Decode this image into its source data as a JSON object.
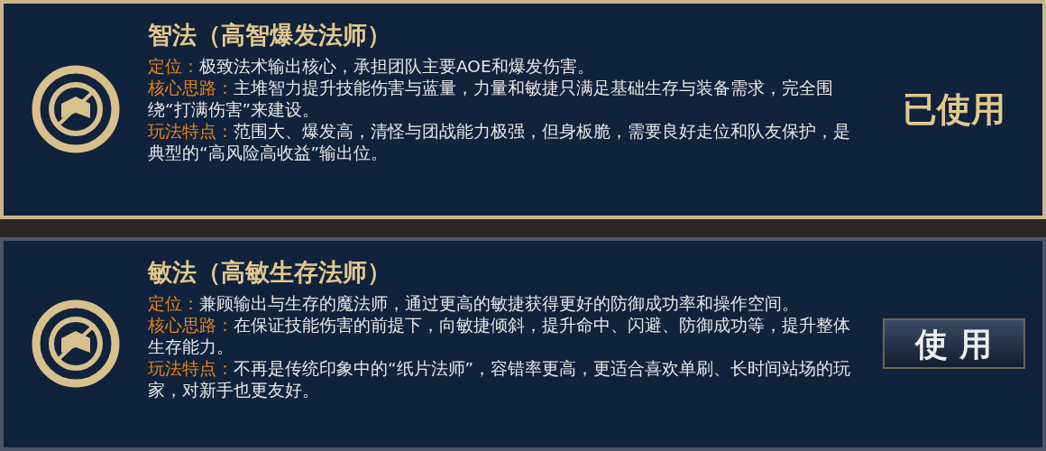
{
  "builds": [
    {
      "title": "智法（高智爆发法师）",
      "used": true,
      "action": "已使用",
      "sections": [
        {
          "label": "定位：",
          "text": "极致法术输出核心，承担团队主要AOE和爆发伤害。"
        },
        {
          "label": "核心思路：",
          "text": "主堆智力提升技能伤害与蓝量，力量和敏捷只满足基础生存与装备需求，完全围绕“打满伤害”来建设。"
        },
        {
          "label": "玩法特点：",
          "text": "范围大、爆发高，清怪与团战能力极强，但身板脆，需要良好走位和队友保护，是典型的“高风险高收益”输出位。"
        }
      ]
    },
    {
      "title": "敏法（高敏生存法师）",
      "used": false,
      "action": "使 用",
      "sections": [
        {
          "label": "定位：",
          "text": "兼顾输出与生存的魔法师，通过更高的敏捷获得更好的防御成功率和操作空间。"
        },
        {
          "label": "核心思路：",
          "text": "在保证技能伤害的前提下，向敏捷倾斜，提升命中、闪避、防御成功等，提升整体生存能力。"
        },
        {
          "label": "玩法特点：",
          "text": "不再是传统印象中的“纸片法师”，容错率更高，更适合喜欢单刷、长时间站场的玩家，对新手也更友好。"
        }
      ]
    }
  ]
}
